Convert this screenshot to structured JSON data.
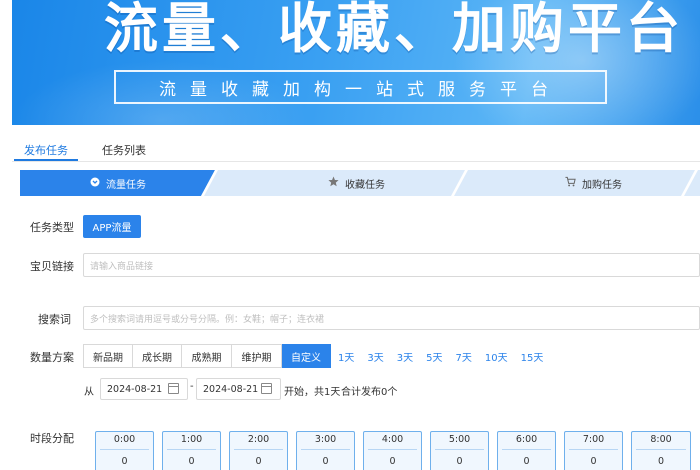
{
  "banner": {
    "title": "流量、收藏、加购平台",
    "subtitle": "流量收藏加构一站式服务平台"
  },
  "tabs": [
    {
      "label": "发布任务",
      "active": true
    },
    {
      "label": "任务列表",
      "active": false
    }
  ],
  "steps": [
    {
      "label": "流量任务",
      "icon": "chevron-down-circle-icon",
      "active": true
    },
    {
      "label": "收藏任务",
      "icon": "star-icon",
      "active": false
    },
    {
      "label": "加购任务",
      "icon": "cart-icon",
      "active": false
    }
  ],
  "form": {
    "task_type_label": "任务类型",
    "task_type_value": "APP流量",
    "link_label": "宝贝链接",
    "link_placeholder": "请输入商品链接",
    "keyword_label": "搜索词",
    "keyword_placeholder": "多个搜索词请用逗号或分号分隔。例：女鞋；帽子；连衣裙",
    "quantity_label": "数量方案",
    "plans": [
      {
        "label": "新品期",
        "active": false
      },
      {
        "label": "成长期",
        "active": false
      },
      {
        "label": "成熟期",
        "active": false
      },
      {
        "label": "维护期",
        "active": false
      },
      {
        "label": "自定义",
        "active": true
      }
    ],
    "days": [
      "1天",
      "3天",
      "3天",
      "5天",
      "7天",
      "10天",
      "15天"
    ],
    "from_label": "从",
    "start_date": "2024-08-21",
    "dash": "-",
    "end_date": "2024-08-21",
    "summary_start": "开始，共1天",
    "summary_total": "合计发布0个",
    "time_label": "时段分配",
    "slots": [
      {
        "time": "0:00",
        "value": "0"
      },
      {
        "time": "1:00",
        "value": "0"
      },
      {
        "time": "2:00",
        "value": "0"
      },
      {
        "time": "3:00",
        "value": "0"
      },
      {
        "time": "4:00",
        "value": "0"
      },
      {
        "time": "5:00",
        "value": "0"
      },
      {
        "time": "6:00",
        "value": "0"
      },
      {
        "time": "7:00",
        "value": "0"
      },
      {
        "time": "8:00",
        "value": "0"
      }
    ]
  },
  "colors": {
    "accent": "#2b83ea",
    "tab_active": "#1f7ae0",
    "step_active": "#2b83ea",
    "step_inactive": "#dbeafa",
    "slot_border": "#6fb0ec"
  }
}
